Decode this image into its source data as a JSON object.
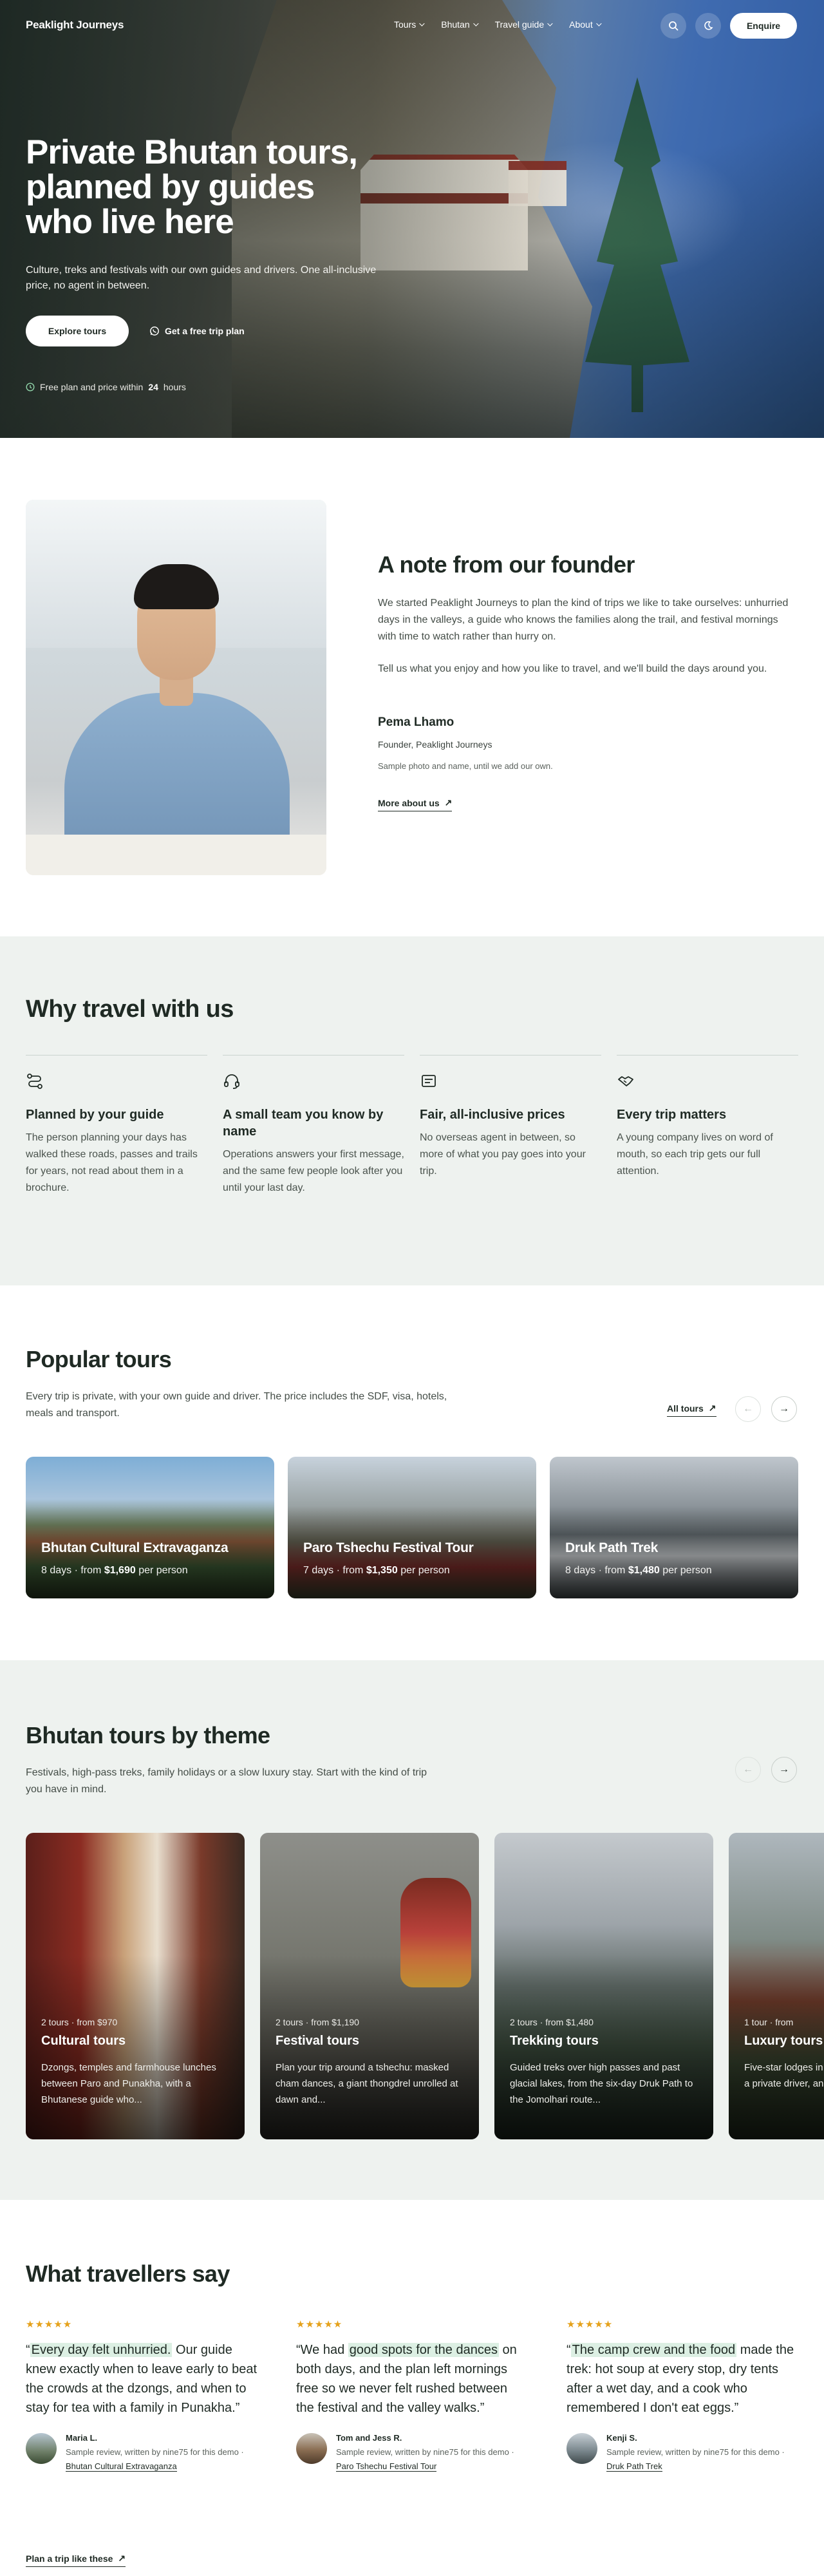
{
  "nav": {
    "logo": "Peaklight Journeys",
    "links": [
      {
        "label": "Tours"
      },
      {
        "label": "Bhutan"
      },
      {
        "label": "Travel guide"
      },
      {
        "label": "About"
      }
    ],
    "search_icon": "search-icon",
    "theme_icon": "moon-icon",
    "enquire": "Enquire"
  },
  "hero": {
    "title": "Private Bhutan tours, planned by guides who live here",
    "subtitle": "Culture, treks and festivals with our own guides and drivers. One all-inclusive price, no agent in between.",
    "primary_cta": "Explore tours",
    "secondary_cta": "Get a free trip plan",
    "note_prefix": "Free plan and price within",
    "note_hours": "24",
    "note_suffix": "hours"
  },
  "founder": {
    "title": "A note from our founder",
    "p1": "We started Peaklight Journeys to plan the kind of trips we like to take ourselves: unhurried days in the valleys, a guide who knows the families along the trail, and festival mornings with time to watch rather than hurry on.",
    "p2": "Tell us what you enjoy and how you like to travel, and we'll build the days around you.",
    "name": "Pema Lhamo",
    "role": "Founder, Peaklight Journeys",
    "disclaimer": "Sample photo and name, until we add our own.",
    "more": "More about us"
  },
  "why": {
    "title": "Why travel with us",
    "items": [
      {
        "icon": "route-icon",
        "title": "Planned by your guide",
        "text": "The person planning your days has walked these roads, passes and trails for years, not read about them in a brochure."
      },
      {
        "icon": "headset-icon",
        "title": "A small team you know by name",
        "text": "Operations answers your first message, and the same few people look after you until your last day."
      },
      {
        "icon": "receipt-icon",
        "title": "Fair, all-inclusive prices",
        "text": "No overseas agent in between, so more of what you pay goes into your trip."
      },
      {
        "icon": "handshake-icon",
        "title": "Every trip matters",
        "text": "A young company lives on word of mouth, so each trip gets our full attention."
      }
    ]
  },
  "popular": {
    "title": "Popular tours",
    "subtitle": "Every trip is private, with your own guide and driver. The price includes the SDF, visa, hotels, meals and transport.",
    "all_tours": "All tours",
    "tours": [
      {
        "name": "Bhutan Cultural Extravaganza",
        "days": "8 days · from",
        "price": "$1,690",
        "per": "per person"
      },
      {
        "name": "Paro Tshechu Festival Tour",
        "days": "7 days · from",
        "price": "$1,350",
        "per": "per person"
      },
      {
        "name": "Druk Path Trek",
        "days": "8 days · from",
        "price": "$1,480",
        "per": "per person"
      }
    ]
  },
  "themes": {
    "title": "Bhutan tours by theme",
    "subtitle": "Festivals, high-pass treks, family holidays or a slow luxury stay. Start with the kind of trip you have in mind.",
    "cards": [
      {
        "meta": "2 tours · from $970",
        "name": "Cultural tours",
        "desc": "Dzongs, temples and farmhouse lunches between Paro and Punakha, with a Bhutanese guide who..."
      },
      {
        "meta": "2 tours · from $1,190",
        "name": "Festival tours",
        "desc": "Plan your trip around a tshechu: masked cham dances, a giant thongdrel unrolled at dawn and..."
      },
      {
        "meta": "2 tours · from $1,480",
        "name": "Trekking tours",
        "desc": "Guided treks over high passes and past glacial lakes, from the six-day Druk Path to the Jomolhari route..."
      },
      {
        "meta": "1 tour · from",
        "name": "Luxury tours",
        "desc": "Five-star lodges in Paro and Thimphu, with a private driver, and"
      }
    ]
  },
  "reviews": {
    "title": "What travellers say",
    "stars": "★★★★★",
    "items": [
      {
        "open": "“",
        "highlight": "Every day felt unhurried.",
        "rest": " Our guide knew exactly when to leave early to beat the crowds at the dzongs, and when to stay for tea with a family in Punakha.”",
        "name": "Maria L.",
        "note": "Sample review, written by nine75 for this demo · ",
        "tour": "Bhutan Cultural Extravaganza"
      },
      {
        "open": "“We had ",
        "highlight": "good spots for the dances",
        "rest": " on both days, and the plan left mornings free so we never felt rushed between the festival and the valley walks.”",
        "name": "Tom and Jess R.",
        "note": "Sample review, written by nine75 for this demo · ",
        "tour": "Paro Tshechu Festival Tour"
      },
      {
        "open": "“",
        "highlight": "The camp crew and the food",
        "rest": " made the trek: hot soup at every stop, dry tents after a wet day, and a cook who remembered I don't eat eggs.”",
        "name": "Kenji S.",
        "note": "Sample review, written by nine75 for this demo · ",
        "tour": "Druk Path Trek"
      }
    ],
    "plan_link": "Plan a trip like these"
  },
  "colors": {
    "accent_bg": "#eef2ef",
    "text": "#1f2a24",
    "star": "#e5a11a",
    "highlight": "#dcefe3"
  }
}
